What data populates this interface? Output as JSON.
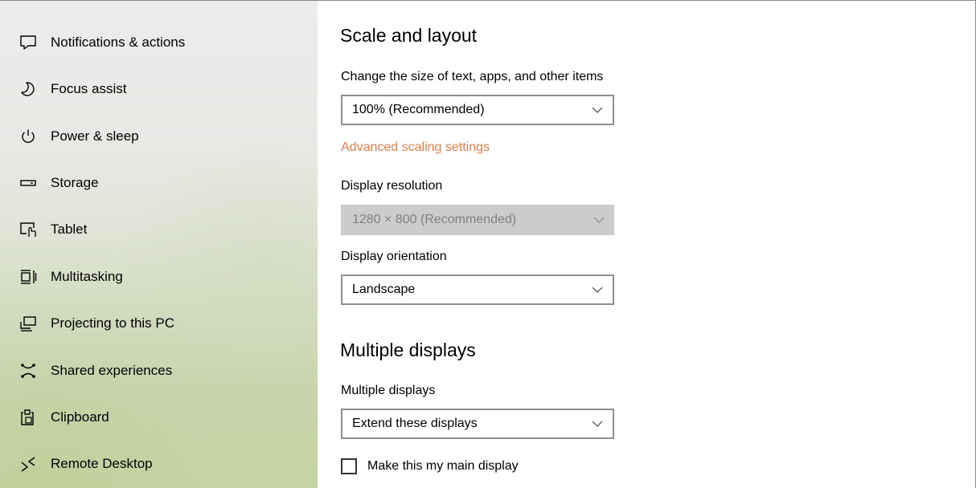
{
  "sidebar": {
    "items": [
      {
        "label": "Notifications & actions",
        "icon": "notifications-icon"
      },
      {
        "label": "Focus assist",
        "icon": "moon-icon"
      },
      {
        "label": "Power & sleep",
        "icon": "power-icon"
      },
      {
        "label": "Storage",
        "icon": "storage-icon"
      },
      {
        "label": "Tablet",
        "icon": "tablet-icon"
      },
      {
        "label": "Multitasking",
        "icon": "multitasking-icon"
      },
      {
        "label": "Projecting to this PC",
        "icon": "projecting-icon"
      },
      {
        "label": "Shared experiences",
        "icon": "shared-experiences-icon"
      },
      {
        "label": "Clipboard",
        "icon": "clipboard-icon"
      },
      {
        "label": "Remote Desktop",
        "icon": "remote-desktop-icon"
      }
    ]
  },
  "scale_layout": {
    "heading": "Scale and layout",
    "size_label": "Change the size of text, apps, and other items",
    "size_value": "100% (Recommended)",
    "advanced_link": "Advanced scaling settings",
    "resolution_label": "Display resolution",
    "resolution_value": "1280 × 800 (Recommended)",
    "orientation_label": "Display orientation",
    "orientation_value": "Landscape"
  },
  "multiple_displays": {
    "heading": "Multiple displays",
    "label": "Multiple displays",
    "value": "Extend these displays",
    "main_display_checkbox": "Make this my main display"
  },
  "colors": {
    "accent_link": "#f07a45",
    "disabled_fill": "#cccccc"
  }
}
